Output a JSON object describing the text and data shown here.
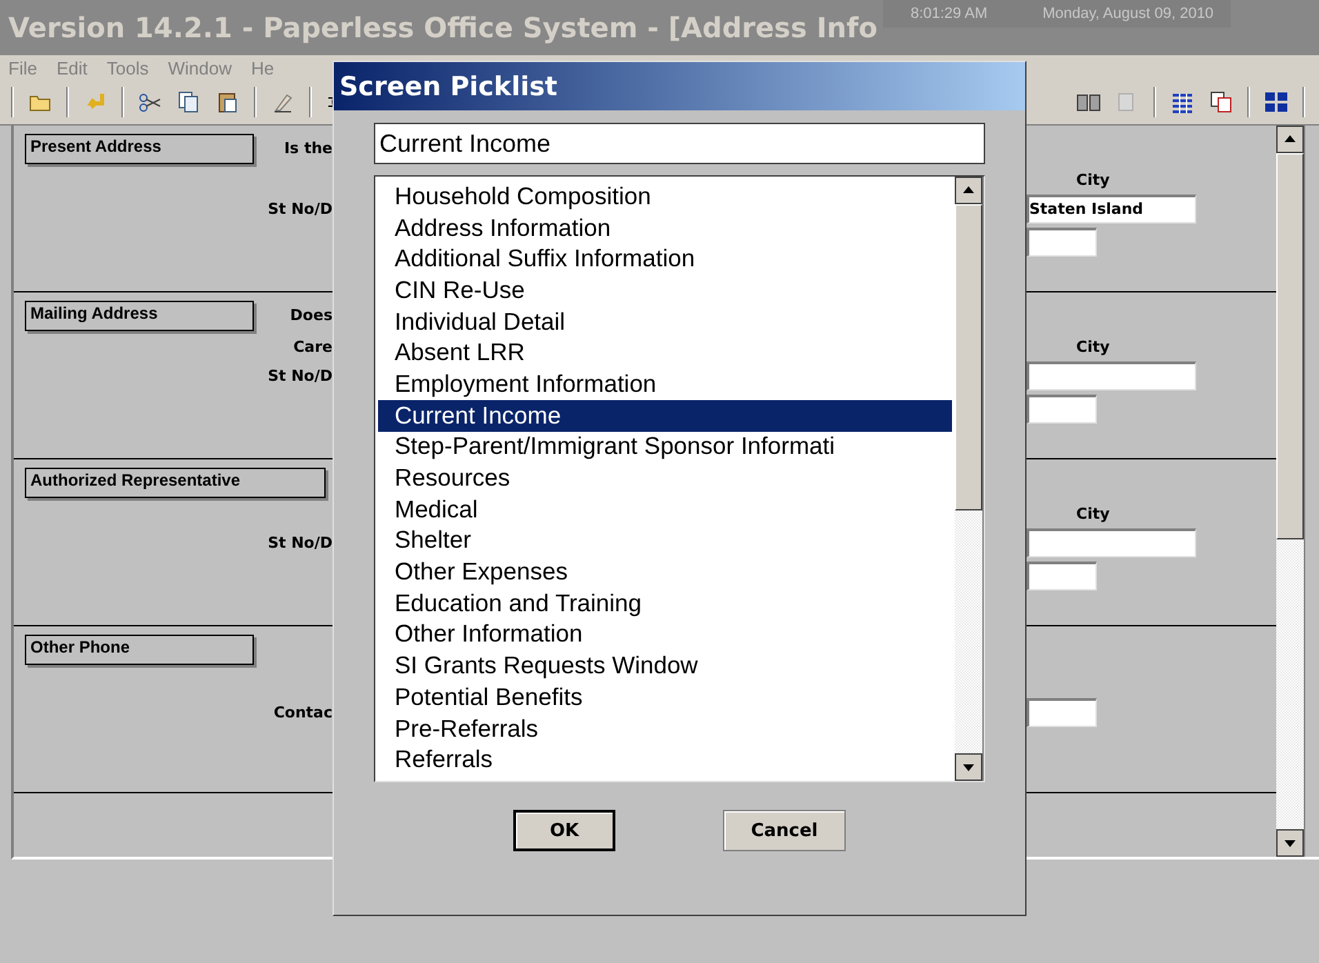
{
  "window": {
    "title": "Version 14.2.1 - Paperless Office System - [Address Info"
  },
  "clock": {
    "time": "8:01:29 AM",
    "date": "Monday, August 09, 2010"
  },
  "menu": [
    "File",
    "Edit",
    "Tools",
    "Window",
    "He"
  ],
  "sections": [
    {
      "header": "Present Address",
      "rows": [
        {
          "kind": "header",
          "label": "Is the"
        },
        {
          "kind": "caption",
          "text": "City"
        },
        {
          "kind": "wide_field",
          "label": "St No/D",
          "value": "Staten Island"
        },
        {
          "kind": "narrow_field"
        }
      ]
    },
    {
      "header": "Mailing Address",
      "rows": [
        {
          "kind": "header",
          "label": "Does"
        },
        {
          "kind": "caption",
          "label": "Care",
          "text": "City"
        },
        {
          "kind": "wide_field",
          "label": "St No/D"
        },
        {
          "kind": "narrow_field"
        }
      ]
    },
    {
      "header": "Authorized Representative",
      "rows": [
        {
          "kind": "header"
        },
        {
          "kind": "caption",
          "text": "City"
        },
        {
          "kind": "wide_field",
          "label": "St No/D"
        },
        {
          "kind": "narrow_field"
        }
      ]
    },
    {
      "header": "Other Phone",
      "rows": [
        {
          "kind": "header"
        },
        {
          "kind": "spacer"
        },
        {
          "kind": "narrow_field",
          "label": "Contac"
        }
      ]
    }
  ],
  "dialog": {
    "title": "Screen Picklist",
    "search": "Current Income",
    "items": [
      {
        "label": "Household Composition",
        "selected": false
      },
      {
        "label": "Address Information",
        "selected": false
      },
      {
        "label": "Additional Suffix Information",
        "selected": false
      },
      {
        "label": "CIN Re-Use",
        "selected": false
      },
      {
        "label": "Individual Detail",
        "selected": false
      },
      {
        "label": "Absent LRR",
        "selected": false
      },
      {
        "label": "Employment Information",
        "selected": false
      },
      {
        "label": "Current Income",
        "selected": true
      },
      {
        "label": "Step-Parent/Immigrant Sponsor Informati",
        "selected": false
      },
      {
        "label": "Resources",
        "selected": false
      },
      {
        "label": "Medical",
        "selected": false
      },
      {
        "label": "Shelter",
        "selected": false
      },
      {
        "label": "Other Expenses",
        "selected": false
      },
      {
        "label": "Education and Training",
        "selected": false
      },
      {
        "label": "Other Information",
        "selected": false
      },
      {
        "label": "SI Grants Requests Window",
        "selected": false
      },
      {
        "label": "Potential Benefits",
        "selected": false
      },
      {
        "label": "Pre-Referrals",
        "selected": false
      },
      {
        "label": "Referrals",
        "selected": false
      }
    ],
    "buttons": [
      {
        "label": "OK",
        "default": true
      },
      {
        "label": "Cancel",
        "default": false
      }
    ]
  }
}
